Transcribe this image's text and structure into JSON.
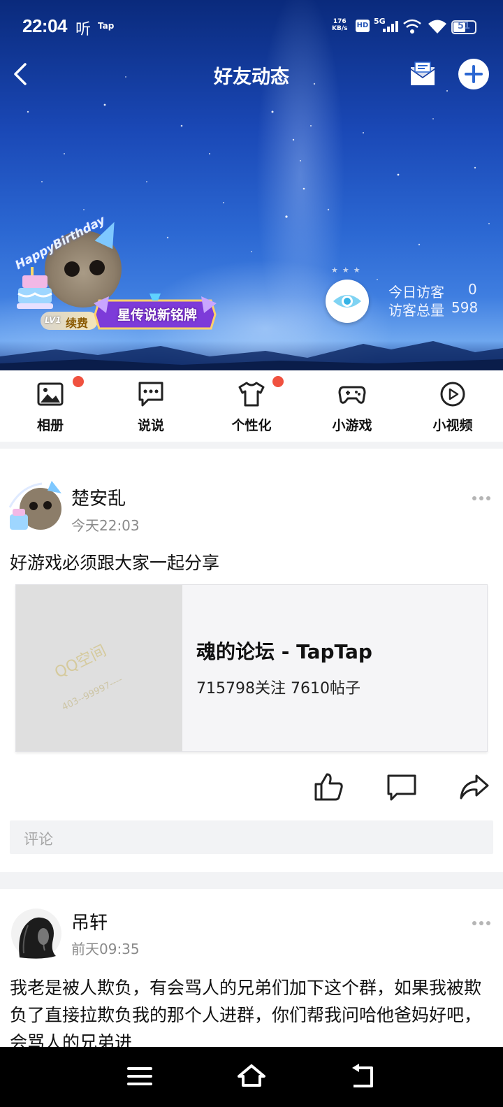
{
  "status_bar": {
    "time": "22:04",
    "ting_icon_text": "听",
    "tap_icon_text": "Tap",
    "net_speed_value": "176",
    "net_speed_unit": "KB/s",
    "hd_label": "HD",
    "network": "5G",
    "battery": "51"
  },
  "header": {
    "title": "好友动态"
  },
  "profile": {
    "avatar_text": "HappyBirthday",
    "level": "LV1",
    "renew_label": "续费",
    "badge_label": "星传说新铭牌"
  },
  "visitors": {
    "today_label": "今日访客",
    "today_count": "0",
    "total_label": "访客总量",
    "total_count": "598"
  },
  "feature_nav": {
    "items": [
      {
        "label": "相册",
        "icon": "photo-album-icon",
        "has_dot": true
      },
      {
        "label": "说说",
        "icon": "chat-bubble-icon",
        "has_dot": false
      },
      {
        "label": "个性化",
        "icon": "tshirt-icon",
        "has_dot": true
      },
      {
        "label": "小游戏",
        "icon": "gamepad-icon",
        "has_dot": false
      },
      {
        "label": "小视频",
        "icon": "play-circle-icon",
        "has_dot": false
      }
    ]
  },
  "posts": [
    {
      "author": "楚安乱",
      "time": "今天22:03",
      "text": "好游戏必须跟大家一起分享",
      "share_card": {
        "title": "魂的论坛 - TapTap",
        "meta": "715798关注 7610帖子",
        "thumb_watermark": "QQ空间",
        "thumb_subtext": "403--99997----"
      },
      "comment_placeholder": "评论"
    },
    {
      "author": "吊轩",
      "time": "前天09:35",
      "text": "我老是被人欺负，有会骂人的兄弟们加下这个群，如果我被欺负了直接拉欺负我的那个人进群，你们帮我问哈他爸妈好吧，会骂人的兄弟进"
    }
  ],
  "colors": {
    "accent_blue": "#2b67d2",
    "notification_red": "#f0513f",
    "divider": "#f2f3f5"
  }
}
